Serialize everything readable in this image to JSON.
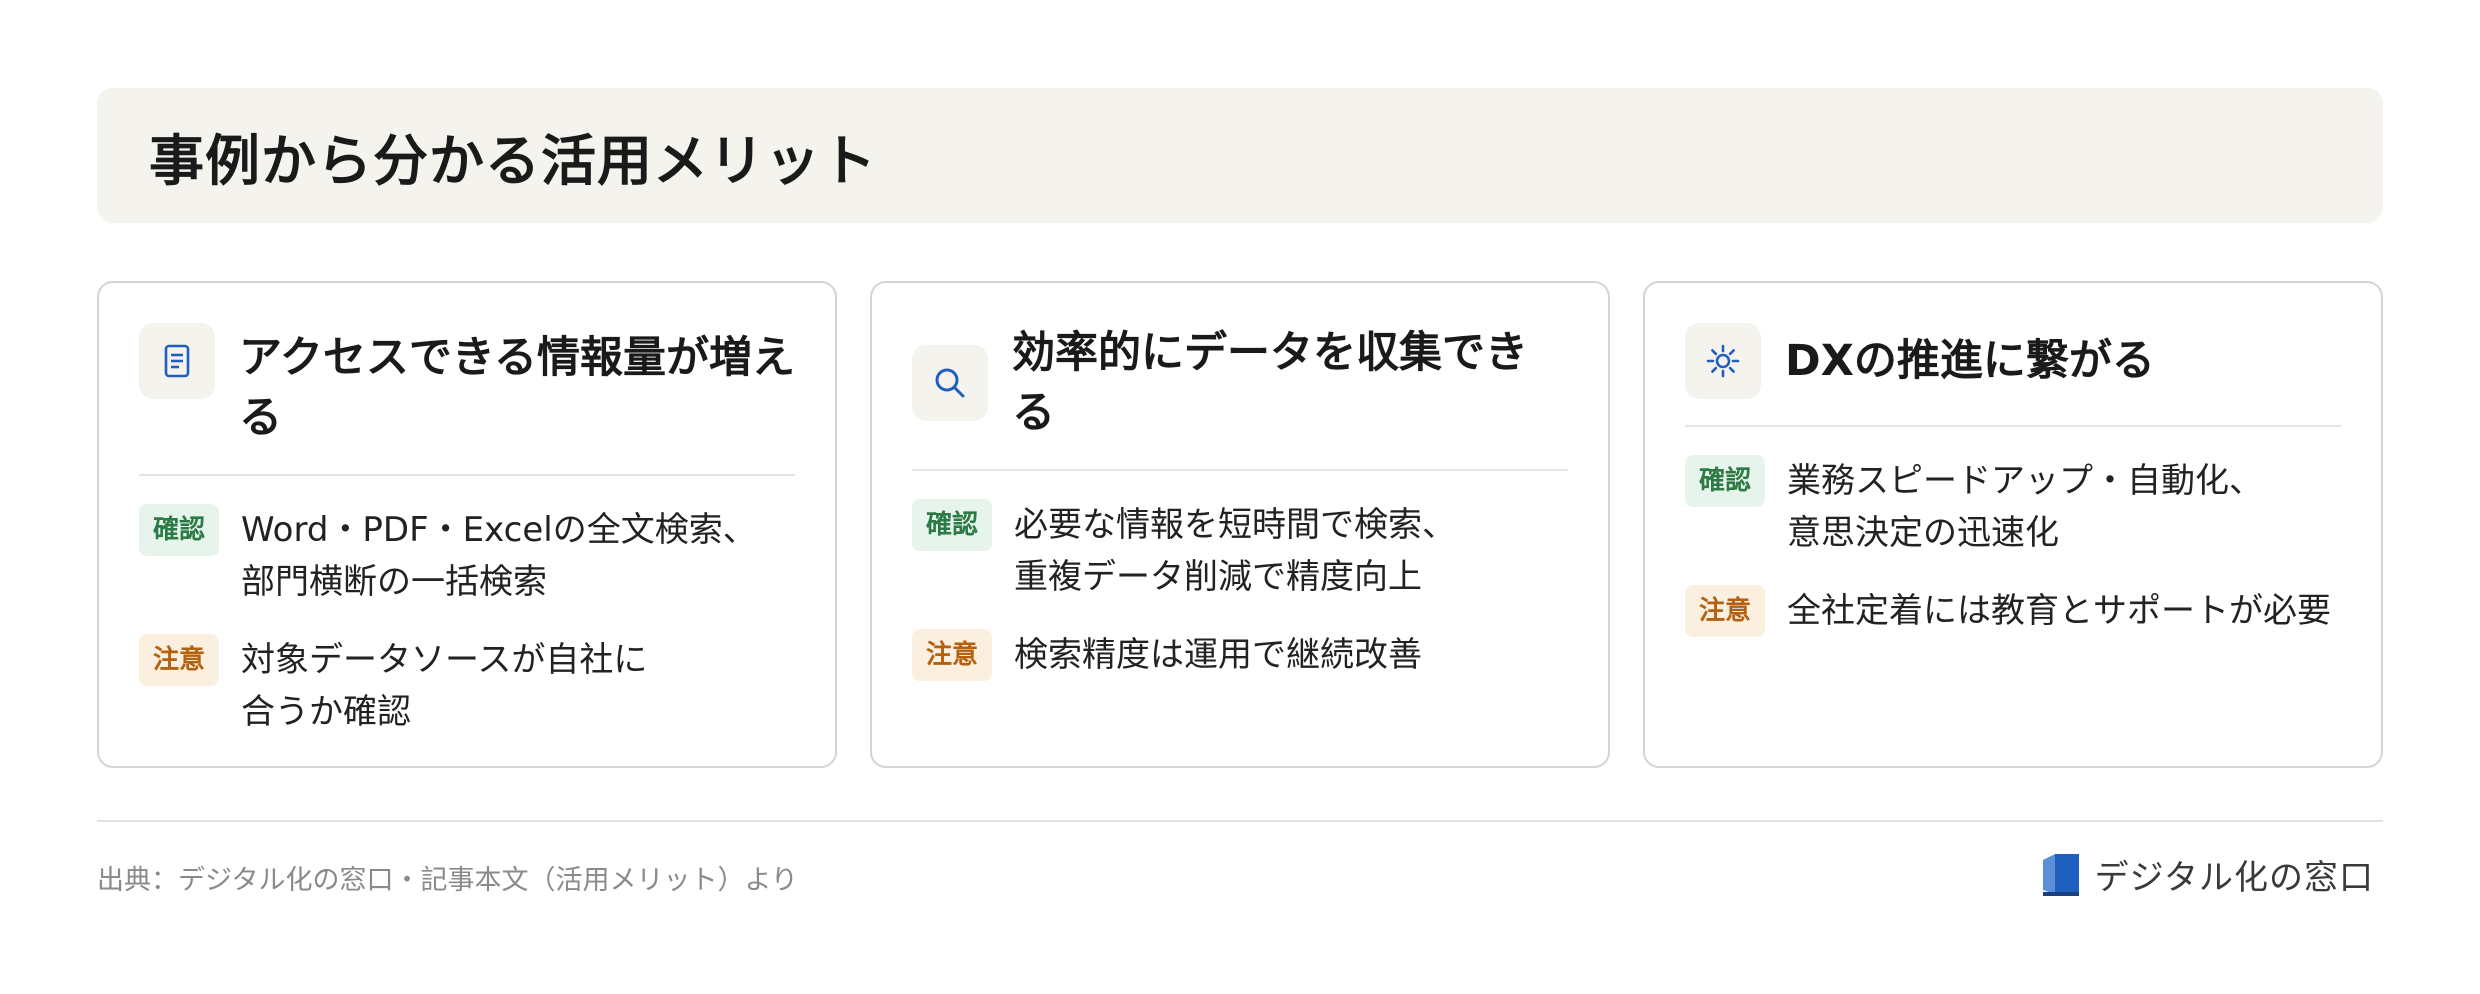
{
  "page": {
    "title": "事例から分かる活用メリット"
  },
  "labels": {
    "confirm": "確認",
    "caution": "注意"
  },
  "cards": [
    {
      "icon": "document-icon",
      "title": "アクセスできる情報量が増える",
      "confirm_text": "Word・PDF・Excelの全文検索、\n部門横断の一括検索",
      "caution_text": "対象データソースが自社に\n合うか確認"
    },
    {
      "icon": "search-icon",
      "title": "効率的にデータを収集できる",
      "confirm_text": "必要な情報を短時間で検索、\n重複データ削減で精度向上",
      "caution_text": "検索精度は運用で継続改善"
    },
    {
      "icon": "sun-gear-icon",
      "title": "DXの推進に繋がる",
      "confirm_text": "業務スピードアップ・自動化、\n意思決定の迅速化",
      "caution_text": "全社定着には教育とサポートが必要"
    }
  ],
  "footer": {
    "source": "出典：デジタル化の窓口・記事本文（活用メリット）より",
    "brand_name": "デジタル化の窓口",
    "brand_icon": "brand-logo-icon"
  },
  "colors": {
    "accent_blue": "#1f5fbf",
    "confirm_green": "#2c7a45",
    "caution_orange": "#b5600f",
    "band_bg": "#f5f3ee"
  }
}
